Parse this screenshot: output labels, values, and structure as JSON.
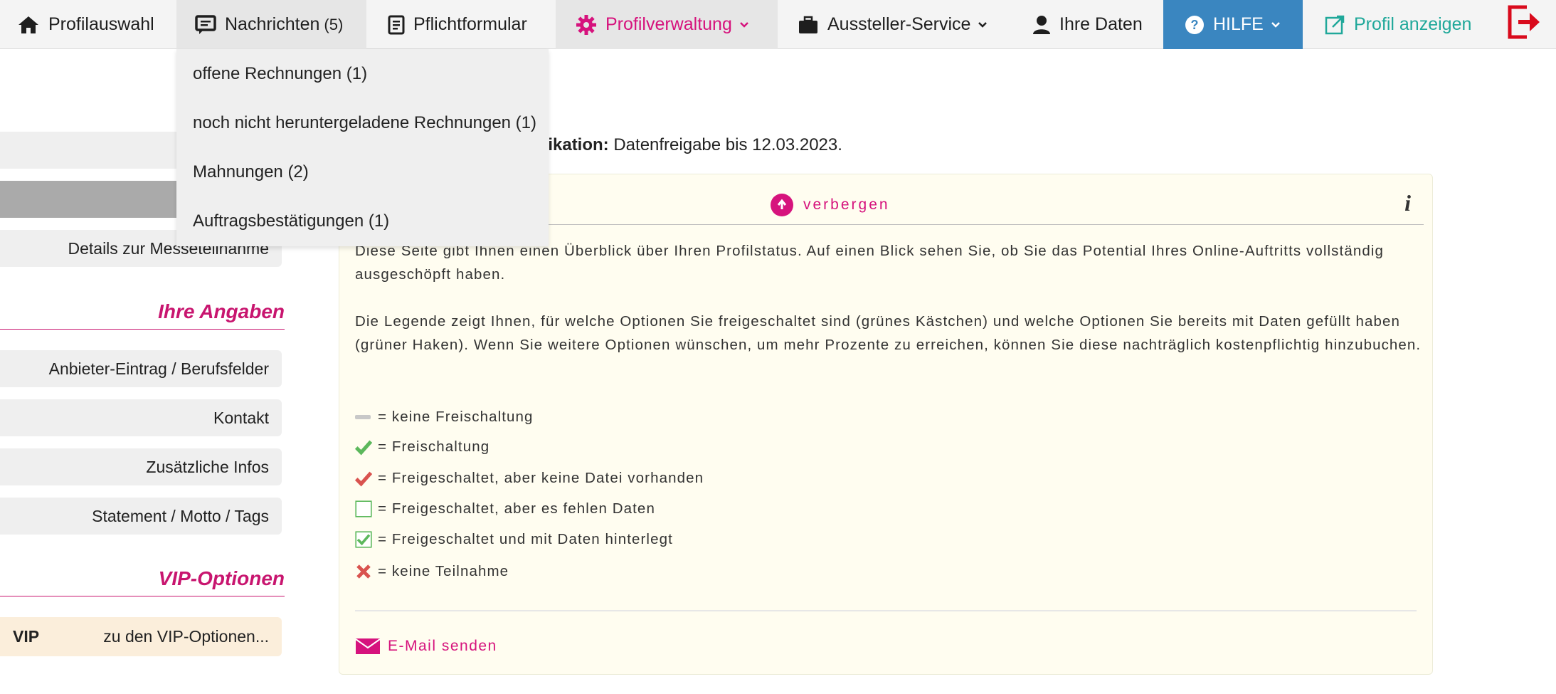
{
  "nav": {
    "profile_select": "Profilauswahl",
    "messages": "Nachrichten",
    "messages_count": "(5)",
    "mandatory_form": "Pflichtformular",
    "profile_admin": "Profilverwaltung",
    "exhibitor_service": "Aussteller-Service",
    "your_data": "Ihre Daten",
    "help": "HILFE",
    "show_profile": "Profil anzeigen"
  },
  "messages_menu": [
    {
      "label": "offene Rechnungen (1)"
    },
    {
      "label": "noch nicht heruntergeladene Rechnungen (1)"
    },
    {
      "label": "Mahnungen (2)"
    },
    {
      "label": "Auftragsbestätigungen (1)"
    }
  ],
  "sidebar": {
    "fair_details": "Details zur Messeteilnahme",
    "section_your_info": "Ihre Angaben",
    "provider_entry": "Anbieter-Eintrag / Berufsfelder",
    "contact": "Kontakt",
    "extra_info": "Zusätzliche Infos",
    "statement": "Statement / Motto / Tags",
    "section_vip": "VIP-Optionen",
    "vip_label": "VIP",
    "vip_link": "zu den VIP-Optionen..."
  },
  "publication": {
    "label": "plikation:",
    "value": "Datenfreigabe bis 12.03.2023."
  },
  "infobox": {
    "hide_label": "verbergen",
    "info_icon_text": "i",
    "para1": "Diese Seite gibt Ihnen einen Überblick über Ihren Profilstatus. Auf einen Blick sehen Sie, ob Sie das Potential Ihres Online-Auftritts vollständig ausgeschöpft haben.",
    "para2": "Die Legende zeigt Ihnen, für welche Optionen Sie freigeschaltet sind (grünes Kästchen) und welche Optionen Sie bereits mit Daten gefüllt haben (grüner Haken). Wenn Sie weitere Optionen wünschen, um mehr Prozente zu erreichen, können Sie diese nachträglich kostenpflichtig hinzubuchen.",
    "legend": {
      "none": "= keine Freischaltung",
      "unlocked": "= Freischaltung",
      "no_file": "= Freigeschaltet, aber keine Datei vorhanden",
      "missing_data": "= Freigeschaltet, aber es fehlen Daten",
      "complete": "= Freigeschaltet und mit Daten hinterlegt",
      "no_participation": "= keine Teilnahme"
    },
    "mail_label": "E-Mail senden"
  },
  "colors": {
    "accent": "#d6137d",
    "help_bg": "#3a86c0",
    "show_profile": "#20a89a",
    "green_check": "#5cb85c",
    "red": "#d9534f"
  }
}
